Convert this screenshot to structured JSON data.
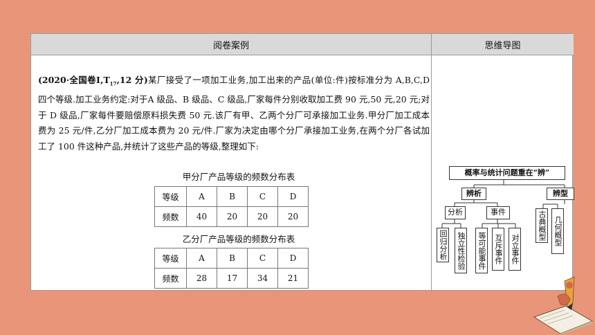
{
  "header": {
    "left_title": "阅卷案例",
    "right_title": "思维导图"
  },
  "problem": {
    "source": "(2020·全国卷Ⅰ,T",
    "sub": "17",
    "score": ",12 分)",
    "body": "某厂接受了一项加工业务,加工出来的产品(单位:件)按标准分为 A,B,C,D 四个等级.加工业务约定:对于A 级品、B 级品、C 级品,厂家每件分别收取加工费 90 元,50 元,20 元;对于 D 级品,厂家每件要赔偿原料损失费 50 元.该厂有甲、乙两个分厂可承接加工业务.甲分厂加工成本费为 25 元/件,乙分厂加工成本费为 20 元/件.厂家为决定由哪个分厂承接加工业务,在两个分厂各试加工了 100 件这种产品,并统计了这些产品的等级,整理如下:"
  },
  "table_a": {
    "title": "甲分厂产品等级的频数分布表",
    "header": [
      "等级",
      "A",
      "B",
      "C",
      "D"
    ],
    "row": [
      "频数",
      "40",
      "20",
      "20",
      "20"
    ]
  },
  "table_b": {
    "title": "乙分厂产品等级的频数分布表",
    "header": [
      "等级",
      "A",
      "B",
      "C",
      "D"
    ],
    "row": [
      "频数",
      "28",
      "17",
      "34",
      "21"
    ]
  },
  "mindmap": {
    "root": "概率与统计问题重在“辨”",
    "branch1": "辨析",
    "branch2": "辨型",
    "sub1": "分析",
    "sub2": "事件",
    "leaves1": [
      "回归分析",
      "独立性检验"
    ],
    "leaves2": [
      "等可能事件",
      "互斥事件",
      "对立事件"
    ],
    "leaves3": [
      "古典概型",
      "几何概型"
    ]
  }
}
